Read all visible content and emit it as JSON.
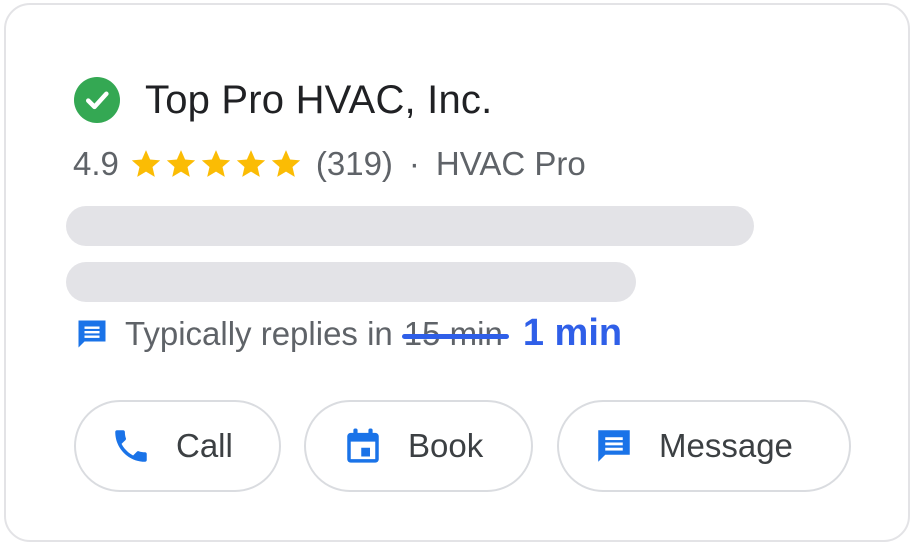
{
  "business": {
    "name": "Top Pro HVAC, Inc.",
    "verified_icon": "verified-check-icon",
    "rating": "4.9",
    "stars": 5,
    "review_count": "(319)",
    "separator": "·",
    "category": "HVAC Pro"
  },
  "reply": {
    "icon": "message-icon",
    "prefix": "Typically replies in",
    "old_time": "15 min",
    "new_time": "1 min"
  },
  "actions": [
    {
      "label": "Call",
      "icon": "phone-icon"
    },
    {
      "label": "Book",
      "icon": "calendar-icon"
    },
    {
      "label": "Message",
      "icon": "message-icon"
    }
  ],
  "colors": {
    "accent": "#2f5fe8",
    "icon_blue": "#1a73e8",
    "star": "#fbbc04",
    "verified": "#34a853",
    "skeleton": "#e3e3e7"
  }
}
